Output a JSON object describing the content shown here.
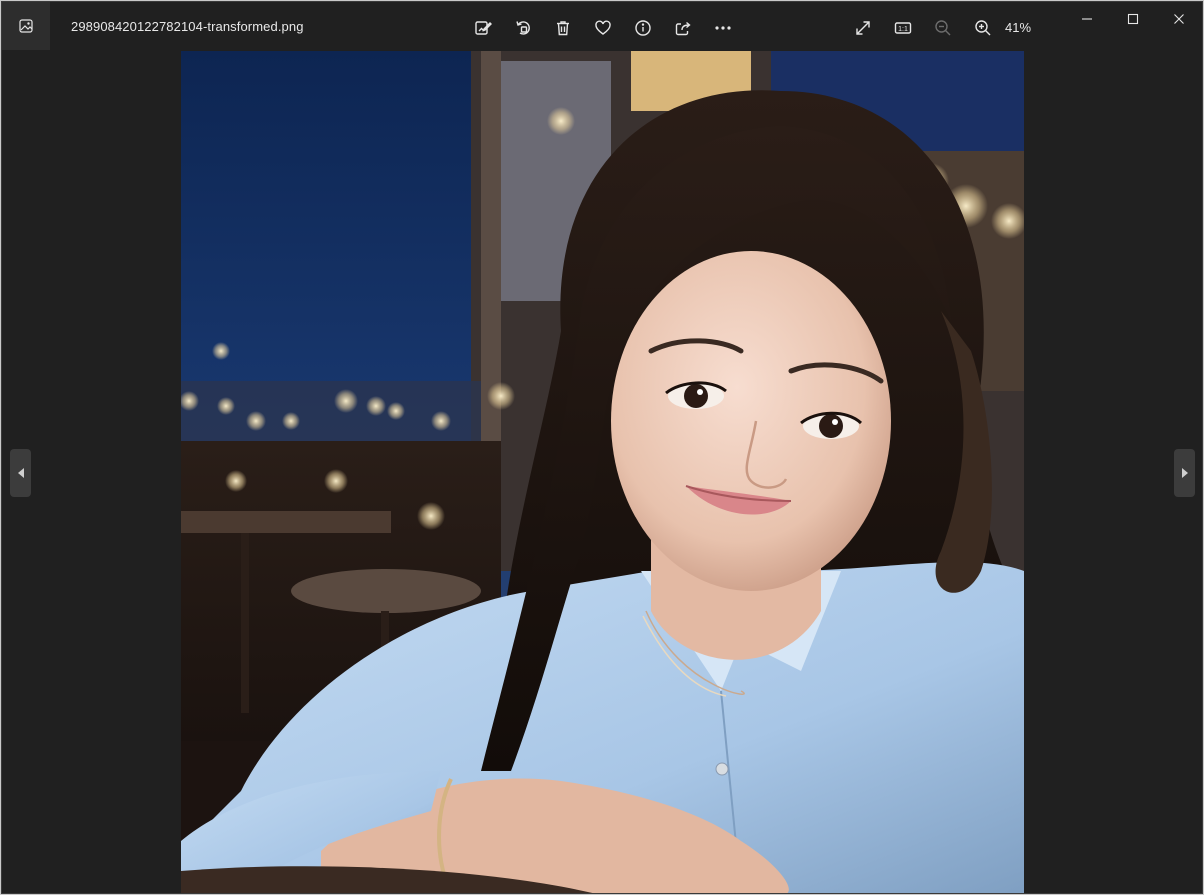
{
  "window": {
    "filename": "298908420122782104-transformed.png",
    "zoom_level": "41%"
  },
  "toolbar": {
    "items": [
      {
        "name": "edit-image-icon",
        "enabled": true
      },
      {
        "name": "rotate-icon",
        "enabled": true
      },
      {
        "name": "delete-icon",
        "enabled": true
      },
      {
        "name": "favorite-heart-icon",
        "enabled": true
      },
      {
        "name": "info-icon",
        "enabled": true
      },
      {
        "name": "share-icon",
        "enabled": true
      },
      {
        "name": "more-options-icon",
        "enabled": true
      },
      {
        "name": "fullscreen-icon",
        "enabled": true
      },
      {
        "name": "actual-size-icon",
        "enabled": true
      },
      {
        "name": "zoom-out-icon",
        "enabled": false
      },
      {
        "name": "zoom-in-icon",
        "enabled": true
      }
    ],
    "actual_size_label": "1:1"
  },
  "window_controls": [
    "minimize-icon",
    "maximize-icon",
    "close-icon"
  ],
  "navigation": [
    "previous-image-arrow",
    "next-image-arrow"
  ],
  "photo": {
    "subject": "portrait-photo",
    "palette": {
      "sky": "#0f2a5c",
      "shirt": "#a8c6e6",
      "hair": "#1c1410",
      "skin": "#e8c2ad",
      "bokeh": "#f2d9a0"
    }
  }
}
